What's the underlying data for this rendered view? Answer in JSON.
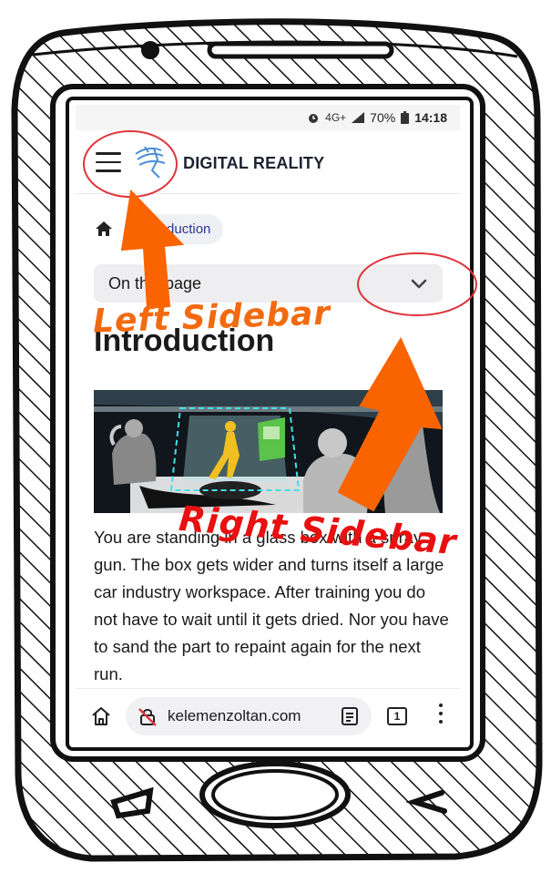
{
  "status_bar": {
    "alarm_icon": "alarm-icon",
    "network": "4G+",
    "signal_icon": "signal-icon",
    "battery": "70%",
    "battery_icon": "battery-icon",
    "time": "14:18"
  },
  "header": {
    "site_title": "DIGITAL REALITY",
    "menu_icon": "hamburger-icon",
    "logo_icon": "logo-icon"
  },
  "breadcrumb": {
    "home_icon": "home-icon",
    "current": "Introduction"
  },
  "on_this_page": {
    "label": "On this page",
    "icon": "chevron-down-icon"
  },
  "main": {
    "heading": "Introduction",
    "paragraph": "You are standing in a glass box with a spray gun. The box gets wider and turns itself a large car industry workspace. After training you do not have to wait until it gets dried. Nor you have to sand the part to repaint again for the next run."
  },
  "browser_bar": {
    "url": "kelemenzoltan.com",
    "tab_count": "1",
    "home_icon": "home-icon",
    "insecure_icon": "not-secure-lock-icon",
    "reader_icon": "reader-mode-icon",
    "menu_icon": "more-vert-icon"
  },
  "annotations": {
    "left": "Left Sidebar",
    "right": "Right Sidebar"
  },
  "colors": {
    "annotation_orange": "#f26a10",
    "annotation_red": "#e81010",
    "circle_red": "#e0343c",
    "breadcrumb_text": "#2b3a8c",
    "logo_blue": "#4a8fd4"
  }
}
